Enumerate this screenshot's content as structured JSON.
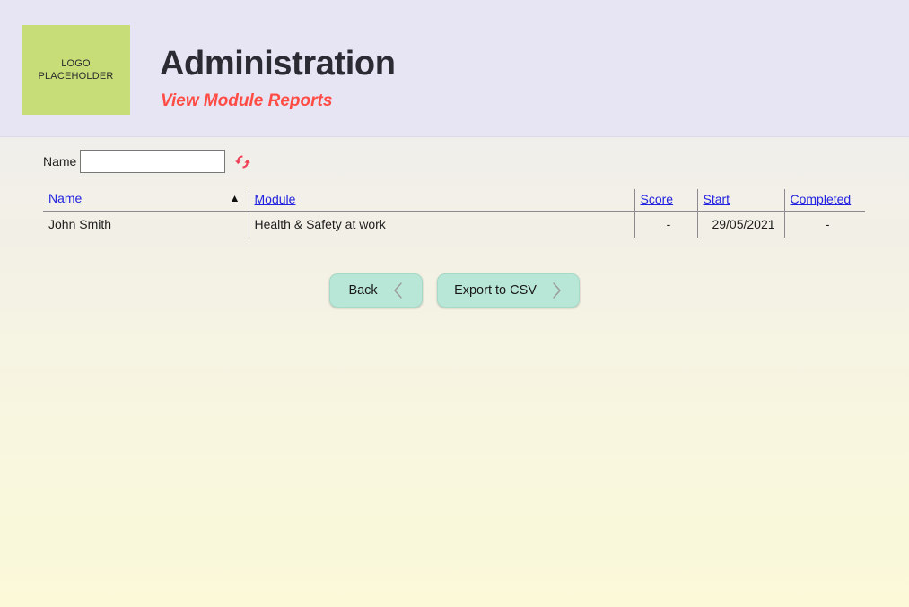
{
  "header": {
    "logo_text": "LOGO\nPLACEHOLDER",
    "logo_color": "#c7dd77",
    "title": "Administration",
    "subtitle": "View Module Reports",
    "subtitle_color": "#ff4d45",
    "band_color": "#e7e5f4"
  },
  "filter": {
    "name_label": "Name",
    "name_value": "",
    "name_placeholder": "",
    "refresh_icon": "refresh-icon",
    "refresh_color": "#ef4055"
  },
  "table": {
    "columns": [
      {
        "label": "Name",
        "key": "name"
      },
      {
        "label": "Module",
        "key": "module"
      },
      {
        "label": "Score",
        "key": "score"
      },
      {
        "label": "Start",
        "key": "start"
      },
      {
        "label": "Completed",
        "key": "completed"
      }
    ],
    "sort": {
      "column": "Name",
      "direction": "asc",
      "indicator": "▲"
    },
    "header_link_color": "#2222e0",
    "rows": [
      {
        "name": "John Smith",
        "module": "Health & Safety at work",
        "score": "-",
        "start": "29/05/2021",
        "completed": "-"
      }
    ]
  },
  "actions": {
    "back_label": "Back",
    "back_icon": "chevron-left-icon",
    "export_label": "Export to CSV",
    "export_icon": "chevron-right-icon",
    "button_color": "#b9e7d7"
  }
}
